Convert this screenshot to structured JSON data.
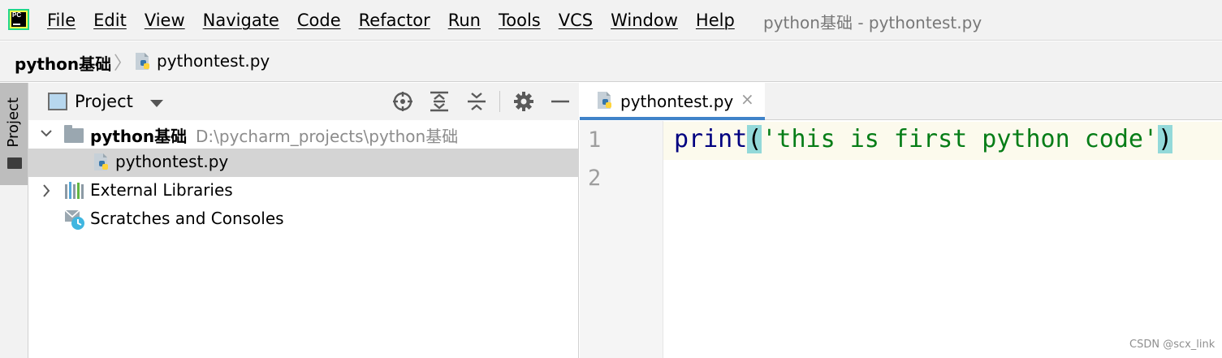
{
  "menubar": {
    "logo": "pycharm-logo",
    "logo_text": "PC",
    "items": [
      "File",
      "Edit",
      "View",
      "Navigate",
      "Code",
      "Refactor",
      "Run",
      "Tools",
      "VCS",
      "Window",
      "Help"
    ],
    "window_title": "python基础 - pythontest.py"
  },
  "breadcrumb": {
    "project": "python基础",
    "separator": "〉",
    "file": "pythontest.py"
  },
  "toolstrip": {
    "tab_label": "Project"
  },
  "project_panel": {
    "title": "Project",
    "icons": [
      "locate-icon",
      "expand-all-icon",
      "collapse-all-icon",
      "gear-icon",
      "minimize-icon"
    ],
    "tree": [
      {
        "label": "python基础",
        "path": "D:\\pycharm_projects\\python基础"
      },
      {
        "label": "pythontest.py",
        "selected": true
      },
      {
        "label": "External Libraries"
      },
      {
        "label": "Scratches and Consoles"
      }
    ]
  },
  "editor": {
    "tab_label": "pythontest.py",
    "tab_close": "×",
    "line_numbers": [
      "1",
      "2"
    ],
    "code": {
      "fn": "print",
      "open_paren": "(",
      "string": "'this is first python code'",
      "close_paren": ")"
    }
  },
  "colors": {
    "tab_underline": "#4083c9",
    "string": "#067d17",
    "function": "#000080",
    "paren_highlight": "#93d9d9"
  },
  "watermark": "CSDN @scx_link"
}
